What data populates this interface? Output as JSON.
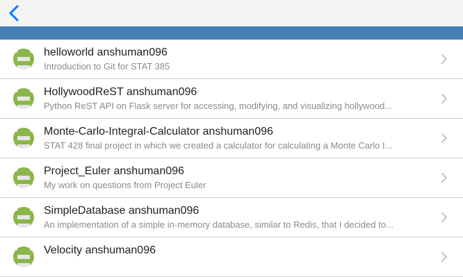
{
  "nav": {
    "back_icon": "chevron-left-icon",
    "accent_color": "#007aff"
  },
  "header_bar": {
    "color": "#4581b7"
  },
  "repos": [
    {
      "title": "helloworld anshuman096",
      "subtitle": "Introduction to Git for STAT 385"
    },
    {
      "title": "HollywoodReST anshuman096",
      "subtitle": "Python ReST API on Flask server for accessing, modifying, and visualizing hollywood..."
    },
    {
      "title": "Monte-Carlo-Integral-Calculator anshuman096",
      "subtitle": "STAT 428 final project in which we created a calculator for calculating a Monte Carlo I..."
    },
    {
      "title": "Project_Euler anshuman096",
      "subtitle": "My work on questions from Project Euler"
    },
    {
      "title": "SimpleDatabase anshuman096",
      "subtitle": "An implementation of a simple in-memory database, similar to Redis, that I decided to..."
    },
    {
      "title": "Velocity anshuman096",
      "subtitle": ""
    }
  ]
}
